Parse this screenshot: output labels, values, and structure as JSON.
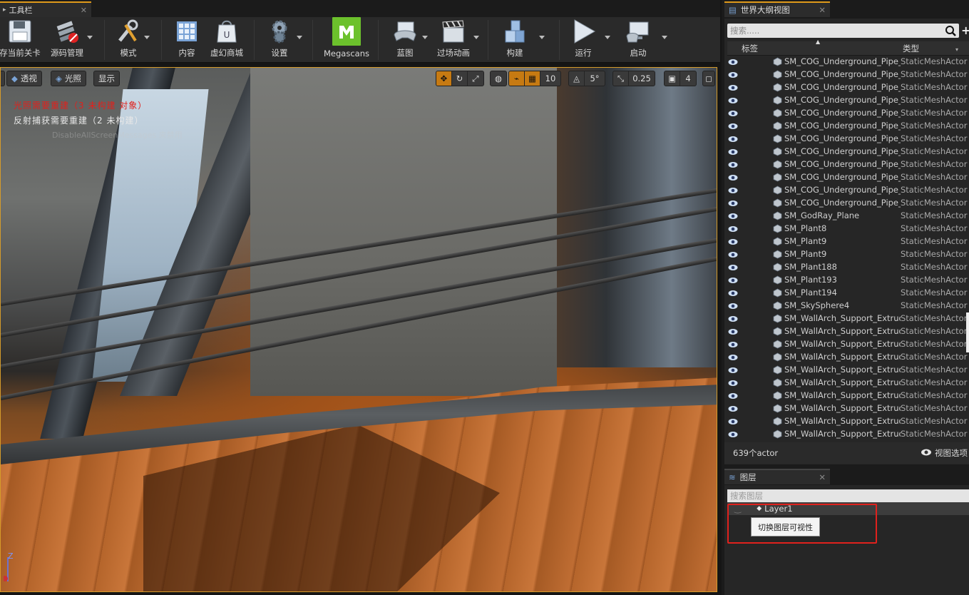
{
  "toolbar_tab": {
    "label": "工具栏"
  },
  "toolbar": {
    "buttons": [
      {
        "label": "存当前关卡",
        "icon": "floppy-disk-icon"
      },
      {
        "label": "源码管理",
        "icon": "source-control-icon"
      },
      {
        "label": "模式",
        "icon": "modes-tools-icon"
      },
      {
        "label": "内容",
        "icon": "content-grid-icon"
      },
      {
        "label": "虚幻商城",
        "icon": "marketplace-bag-icon"
      },
      {
        "label": "设置",
        "icon": "settings-gear-icon"
      },
      {
        "label": "Megascans",
        "icon": "megascans-logo-icon"
      },
      {
        "label": "蓝图",
        "icon": "blueprint-gamepad-icon"
      },
      {
        "label": "过场动画",
        "icon": "clapperboard-icon"
      },
      {
        "label": "构建",
        "icon": "build-blocks-icon"
      },
      {
        "label": "运行",
        "icon": "play-icon"
      },
      {
        "label": "启动",
        "icon": "launch-icon"
      }
    ]
  },
  "viewport": {
    "perspective_label": "透视",
    "lit_label": "光照",
    "show_label": "显示",
    "grid_snap": "10",
    "rotation_snap": "5°",
    "scale_snap": "0.25",
    "camera_speed": "4",
    "messages": {
      "lighting": "光照需要重建（3 未构建 对象）",
      "reflection": "反射捕获需要重建（2 未构建）",
      "faded": "DisableAllScreenMessages 来禁用"
    },
    "axis_label": "Z"
  },
  "outliner": {
    "tab_label": "世界大纲视图",
    "search_placeholder": "搜索.....",
    "col_label": "标签",
    "col_type": "类型",
    "rows": [
      {
        "name": "SM_COG_Underground_Pipe_V",
        "type": "StaticMeshActor"
      },
      {
        "name": "SM_COG_Underground_Pipe_V",
        "type": "StaticMeshActor"
      },
      {
        "name": "SM_COG_Underground_Pipe_V",
        "type": "StaticMeshActor"
      },
      {
        "name": "SM_COG_Underground_Pipe_V",
        "type": "StaticMeshActor"
      },
      {
        "name": "SM_COG_Underground_Pipe_V",
        "type": "StaticMeshActor"
      },
      {
        "name": "SM_COG_Underground_Pipe_V",
        "type": "StaticMeshActor"
      },
      {
        "name": "SM_COG_Underground_Pipe_V",
        "type": "StaticMeshActor"
      },
      {
        "name": "SM_COG_Underground_Pipe_V",
        "type": "StaticMeshActor"
      },
      {
        "name": "SM_COG_Underground_Pipe_V",
        "type": "StaticMeshActor"
      },
      {
        "name": "SM_COG_Underground_Pipe_V",
        "type": "StaticMeshActor"
      },
      {
        "name": "SM_COG_Underground_Pipe_V",
        "type": "StaticMeshActor"
      },
      {
        "name": "SM_COG_Underground_Pipe_V",
        "type": "StaticMeshActor"
      },
      {
        "name": "SM_GodRay_Plane",
        "type": "StaticMeshActor"
      },
      {
        "name": "SM_Plant8",
        "type": "StaticMeshActor"
      },
      {
        "name": "SM_Plant9",
        "type": "StaticMeshActor"
      },
      {
        "name": "SM_Plant9",
        "type": "StaticMeshActor"
      },
      {
        "name": "SM_Plant188",
        "type": "StaticMeshActor"
      },
      {
        "name": "SM_Plant193",
        "type": "StaticMeshActor"
      },
      {
        "name": "SM_Plant194",
        "type": "StaticMeshActor"
      },
      {
        "name": "SM_SkySphere4",
        "type": "StaticMeshActor"
      },
      {
        "name": "SM_WallArch_Support_Extrude",
        "type": "StaticMeshActor"
      },
      {
        "name": "SM_WallArch_Support_Extrude",
        "type": "StaticMeshActor"
      },
      {
        "name": "SM_WallArch_Support_Extrude",
        "type": "StaticMeshActor"
      },
      {
        "name": "SM_WallArch_Support_Extrude",
        "type": "StaticMeshActor"
      },
      {
        "name": "SM_WallArch_Support_Extrude",
        "type": "StaticMeshActor"
      },
      {
        "name": "SM_WallArch_Support_Extrude",
        "type": "StaticMeshActor"
      },
      {
        "name": "SM_WallArch_Support_Extrude",
        "type": "StaticMeshActor"
      },
      {
        "name": "SM_WallArch_Support_Extrude",
        "type": "StaticMeshActor"
      },
      {
        "name": "SM_WallArch_Support_Extrude",
        "type": "StaticMeshActor"
      },
      {
        "name": "SM_WallArch_Support_Extrude",
        "type": "StaticMeshActor"
      }
    ],
    "actor_count": "639个actor",
    "view_options": "视图选项"
  },
  "layers": {
    "tab_label": "图层",
    "search_placeholder": "搜索图层",
    "layer_name": "Layer1",
    "tooltip": "切换图层可视性"
  },
  "colors": {
    "accent": "#e09a1a",
    "warning": "#e0211d",
    "highlight": "#c67a12"
  }
}
